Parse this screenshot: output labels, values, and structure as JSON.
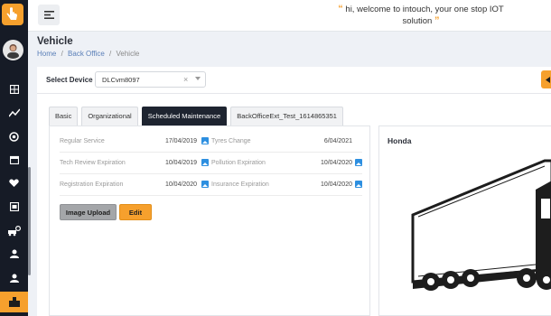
{
  "topbar": {
    "welcome_line1": "hi, welcome to intouch, your one stop IOT",
    "welcome_line2": "solution",
    "quote_open": "“",
    "quote_close": "”"
  },
  "page": {
    "title": "Vehicle",
    "breadcrumb": [
      "Home",
      "Back Office",
      "Vehicle"
    ],
    "breadcrumb_sep": "/"
  },
  "device": {
    "label": "Select Device",
    "selected": "DLCvm8097",
    "clear_glyph": "×"
  },
  "tabs": [
    {
      "label": "Basic",
      "active": false
    },
    {
      "label": "Organizational",
      "active": false
    },
    {
      "label": "Scheduled Maintenance",
      "active": true
    },
    {
      "label": "BackOfficeExt_Test_1614865351",
      "active": false
    }
  ],
  "maintenance": {
    "rows": [
      {
        "left": {
          "label": "Regular Service",
          "value": "17/04/2019"
        },
        "right": {
          "label": "Tyres Change",
          "value": "6/04/2021"
        }
      },
      {
        "left": {
          "label": "Tech Review Expiration",
          "value": "10/04/2019"
        },
        "right": {
          "label": "Pollution Expiration",
          "value": "10/04/2020"
        }
      },
      {
        "left": {
          "label": "Registration Expiration",
          "value": "10/04/2020"
        },
        "right": {
          "label": "Insurance Expiration",
          "value": "10/04/2020"
        }
      }
    ],
    "image_upload_label": "Image Upload",
    "edit_label": "Edit"
  },
  "vehicle": {
    "name": "Honda"
  },
  "colors": {
    "accent": "#f6a02d",
    "sidebar": "#161b26",
    "active_tab": "#1e2430",
    "image_icon": "#2d8fe0"
  },
  "sidebar_icons": [
    "hand-pointer-icon",
    "avatar",
    "grid-icon",
    "chart-line-icon",
    "life-ring-icon",
    "calendar-icon",
    "heart-icon",
    "clipboard-icon",
    "vehicle-location-icon",
    "user-icon",
    "building-icon",
    "user-alt-icon"
  ]
}
